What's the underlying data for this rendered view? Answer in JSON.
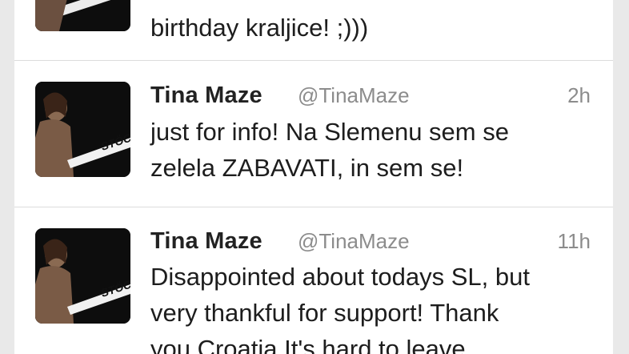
{
  "tweets": [
    {
      "name": "",
      "handle": "",
      "time": "",
      "lines": [
        "birthday kraljice! ;)))"
      ]
    },
    {
      "name": "Tina Maze",
      "handle": "@TinaMaze",
      "time": "2h",
      "lines": [
        "just for info! Na Slemenu sem se",
        "zelela ZABAVATI, in sem se!"
      ]
    },
    {
      "name": "Tina Maze",
      "handle": "@TinaMaze",
      "time": "11h",
      "lines": [
        "Disappointed about todays SL, but",
        "very thankful for support! Thank",
        "you Croatia It's hard to leave"
      ]
    }
  ],
  "avatar": {
    "icon": "profile-photo-avatar",
    "text": "STÖCKLI"
  },
  "colors": {
    "background": "#e9e9e9",
    "card": "#ffffff",
    "name": "#222222",
    "meta": "#8c8c8c",
    "divider": "#dcdcdc"
  }
}
